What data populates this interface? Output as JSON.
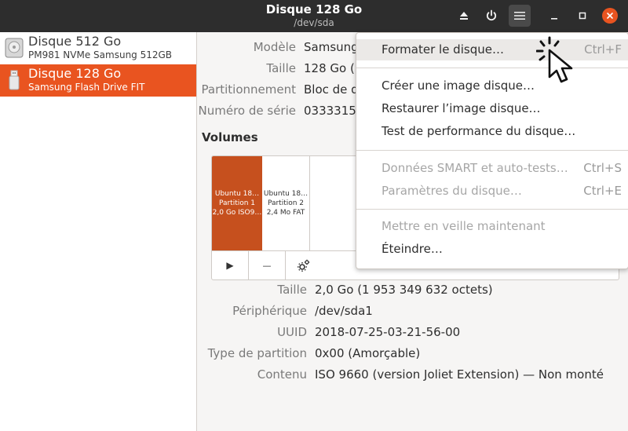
{
  "window": {
    "title": "Disque 128 Go",
    "subtitle": "/dev/sda"
  },
  "header_icons": [
    "eject-icon",
    "power-icon",
    "hamburger-menu-icon",
    "minimize-icon",
    "maximize-icon",
    "close-icon"
  ],
  "sidebar": {
    "drives": [
      {
        "name": "Disque 512 Go",
        "model": "PM981 NVMe Samsung 512GB",
        "icon": "hard-disk-icon",
        "selected": false
      },
      {
        "name": "Disque 128 Go",
        "model": "Samsung Flash Drive FIT",
        "icon": "usb-drive-icon",
        "selected": true
      }
    ]
  },
  "disk_info": {
    "model_label": "Modèle",
    "model_value": "Samsung",
    "size_label": "Taille",
    "size_value": "128 Go (",
    "partitioning_label": "Partitionnement",
    "partitioning_value": "Bloc de d",
    "serial_label": "Numéro de série",
    "serial_value": "03333151"
  },
  "volumes": {
    "title": "Volumes",
    "partitions": [
      {
        "line1": "Ubuntu 18…",
        "line2": "Partition 1",
        "line3": "2,0 Go ISO9…"
      },
      {
        "line1": "Ubuntu 18…",
        "line2": "Partition 2",
        "line3": "2,4 Mo FAT"
      }
    ],
    "tools": {
      "play": "▶",
      "minus": "—"
    }
  },
  "volume_info": {
    "size_label": "Taille",
    "size_value": "2,0 Go (1 953 349 632 octets)",
    "device_label": "Périphérique",
    "device_value": "/dev/sda1",
    "uuid_label": "UUID",
    "uuid_value": "2018-07-25-03-21-56-00",
    "ptype_label": "Type de partition",
    "ptype_value": "0x00 (Amorçable)",
    "content_label": "Contenu",
    "content_value": "ISO 9660 (version Joliet Extension) — Non monté"
  },
  "menu": {
    "format": {
      "label": "Formater le disque…",
      "accel": "Ctrl+F"
    },
    "create_image": {
      "label": "Créer une image disque…"
    },
    "restore_image": {
      "label": "Restaurer l’image disque…"
    },
    "benchmark": {
      "label": "Test de performance du disque…"
    },
    "smart": {
      "label": "Données SMART et auto-tests…",
      "accel": "Ctrl+S"
    },
    "settings": {
      "label": "Paramètres du disque…",
      "accel": "Ctrl+E"
    },
    "standby": {
      "label": "Mettre en veille maintenant"
    },
    "power_off": {
      "label": "Éteindre…"
    }
  },
  "colors": {
    "accent": "#e95420",
    "titlebar": "#2d2d2d",
    "partition_selected": "#c6501e"
  }
}
